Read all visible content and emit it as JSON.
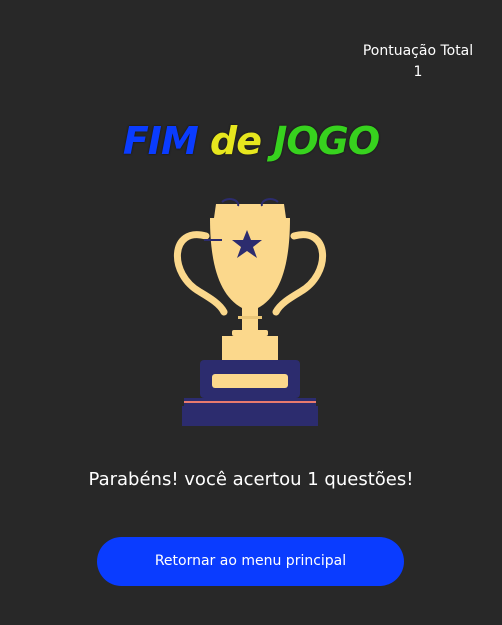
{
  "score": {
    "label": "Pontuação Total",
    "value": "1"
  },
  "title": {
    "word1": "FIM",
    "word2": "de",
    "word3": "JOGO",
    "colors": {
      "word1": "#0a3cff",
      "word2": "#e6e61e",
      "word3": "#37d21e"
    }
  },
  "trophy": {
    "icon": "trophy-icon",
    "cup_color": "#fbd88c",
    "base_color": "#2c2c6e",
    "star_color": "#2c2c6e"
  },
  "message": "Parabéns! você acertou 1 questões!",
  "button": {
    "label": "Retornar ao menu principal",
    "color": "#0a3cff"
  }
}
